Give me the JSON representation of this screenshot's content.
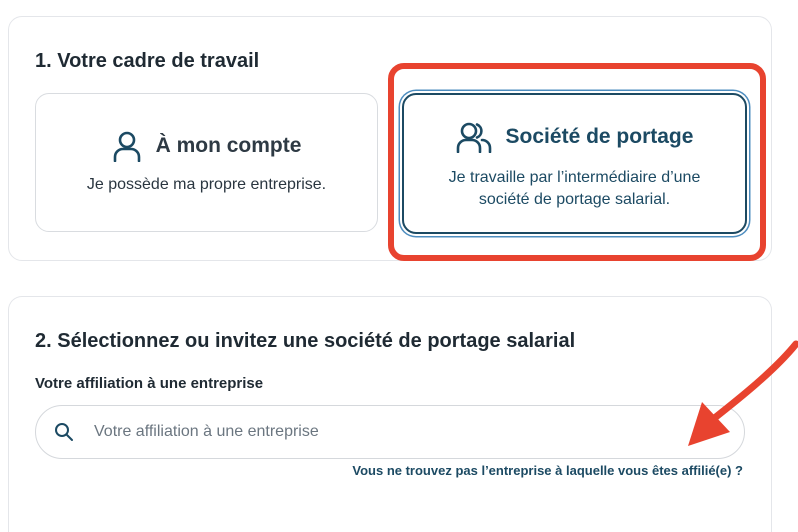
{
  "section1": {
    "title": "1. Votre cadre de travail",
    "options": [
      {
        "icon": "person-icon",
        "title": "À mon compte",
        "description": "Je possède ma propre entreprise.",
        "selected": false
      },
      {
        "icon": "people-icon",
        "title": "Société de portage",
        "description": "Je travaille par l’intermédiaire d’une société de portage salarial.",
        "selected": true
      }
    ]
  },
  "section2": {
    "title": "2. Sélectionnez ou invitez une société de portage salarial",
    "field_label": "Votre affiliation à une entreprise",
    "search_icon": "search-icon",
    "search_placeholder": "Votre affiliation à une entreprise",
    "search_value": "",
    "help_link": "Vous ne trouvez pas l’entreprise à laquelle vous êtes affilié(e) ?"
  },
  "annotations": {
    "highlight_color": "#e8432f",
    "arrow_color": "#e8432f"
  },
  "colors": {
    "primary": "#1c4a63",
    "border": "#d9dce0",
    "selected_ring": "#4d8dbf"
  }
}
